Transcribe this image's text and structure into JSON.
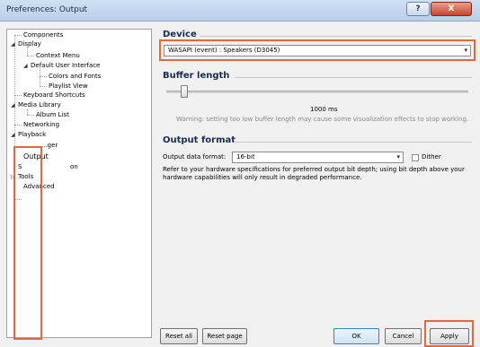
{
  "window": {
    "title": "Preferences: Output",
    "help_label": "?",
    "close_label": "X"
  },
  "tree": {
    "items": [
      {
        "label": "Components"
      },
      {
        "label": "Display",
        "expander": "◢"
      },
      {
        "label": "Context Menu"
      },
      {
        "label": "Default User Interface",
        "expander": "◢"
      },
      {
        "label": "Colors and Fonts"
      },
      {
        "label": "Playlist View"
      },
      {
        "label": "Keyboard Shortcuts"
      },
      {
        "label": "Media Library",
        "expander": "◢"
      },
      {
        "label": "Album List"
      },
      {
        "label": "Networking"
      },
      {
        "label": "Playback",
        "expander": "◢"
      },
      {
        "label": "...ger"
      },
      {
        "label": "Output"
      },
      {
        "label": "S",
        "trail": "on"
      },
      {
        "label": "Tools",
        "expander": "▷"
      },
      {
        "label": "Advanced"
      }
    ]
  },
  "device": {
    "heading": "Device",
    "selected": "WASAPI (event) : Speakers (D3045)",
    "arrow": "▾"
  },
  "buffer": {
    "heading": "Buffer length",
    "value_label": "1000 ms",
    "slider_value_ms": 1000,
    "warning": "Warning: setting too low buffer length may cause some visualization effects to stop working."
  },
  "output_format": {
    "heading": "Output format",
    "label": "Output data format:",
    "selected": "16-bit",
    "arrow": "▾",
    "dither_label": "Dither",
    "dither_checked": false,
    "help_line1": "Refer to your hardware specifications for preferred output bit depth; using bit depth above your",
    "help_line2": "hardware capabilities will only result in degraded performance."
  },
  "buttons": {
    "reset_all": "Reset all",
    "reset_page": "Reset page",
    "ok": "OK",
    "cancel": "Cancel",
    "apply": "Apply"
  },
  "colors": {
    "highlight": "#e06a3c",
    "heading": "#1b2d4f"
  }
}
